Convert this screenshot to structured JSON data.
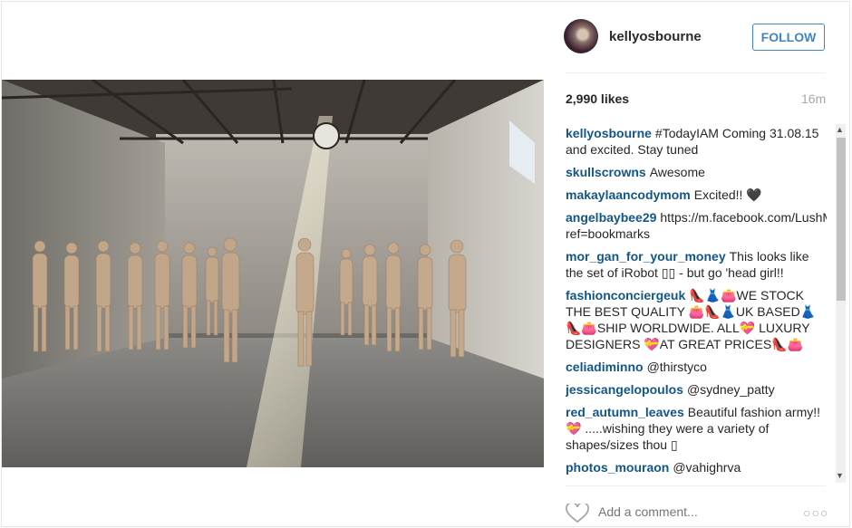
{
  "post": {
    "username": "kellyosbourne",
    "follow_label": "FOLLOW",
    "likes": "2,990 likes",
    "time": "16m",
    "comments": [
      {
        "user": "kellyosbourne",
        "text": "#TodayIAM Coming 31.08.15 and excited. Stay tuned"
      },
      {
        "user": "skullscrowns",
        "text": "Awesome"
      },
      {
        "user": "makaylaancodymom",
        "text": "Excited!! 🖤"
      },
      {
        "user": "angelbaybee29",
        "text": "https://m.facebook.com/LushMummyELB?ref=bookmarks"
      },
      {
        "user": "mor_gan_for_your_money",
        "text": "This looks like the set of iRobot ▯▯ - but go 'head girl!!"
      },
      {
        "user": "fashionconciergeuk",
        "text": "👠👗👛WE STOCK THE BEST QUALITY 👛👠👗UK BASED👗👠👛SHIP WORLDWIDE. ALL💝 LUXURY DESIGNERS 💝AT GREAT PRICES👠👛"
      },
      {
        "user": "celiadiminno",
        "text": "@thirstyco"
      },
      {
        "user": "jessicangelopoulos",
        "text": "@sydney_patty"
      },
      {
        "user": "red_autumn_leaves",
        "text": "Beautiful fashion army!! 💝 .....wishing they were a variety of shapes/sizes thou ▯"
      },
      {
        "user": "photos_mouraon",
        "text": "@vahighrva"
      }
    ],
    "add_comment_placeholder": "Add a comment...",
    "more_label": "○○○"
  },
  "icons": {
    "avatar": "avatar",
    "heart": "heart-icon",
    "more": "more-options-icon"
  },
  "colors": {
    "accent": "#3f86c3",
    "username_link": "#125688",
    "muted": "#a5a7aa"
  }
}
